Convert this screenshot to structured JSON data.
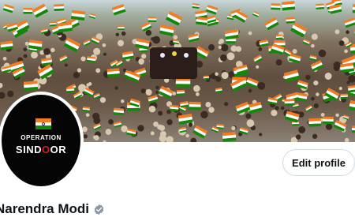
{
  "profile": {
    "name": "Narendra Modi",
    "verified": true,
    "edit_button_label": "Edit profile"
  },
  "avatar": {
    "line1": "OPERATION",
    "line2": "SINDOOR",
    "background": "#050505",
    "accent": "#d21f1f"
  },
  "banner": {
    "description_icon": "crowd-with-flags-banner"
  },
  "colors": {
    "saffron": "#f47b20",
    "white": "#ffffff",
    "green": "#138808",
    "badge": "#8b98a5"
  }
}
